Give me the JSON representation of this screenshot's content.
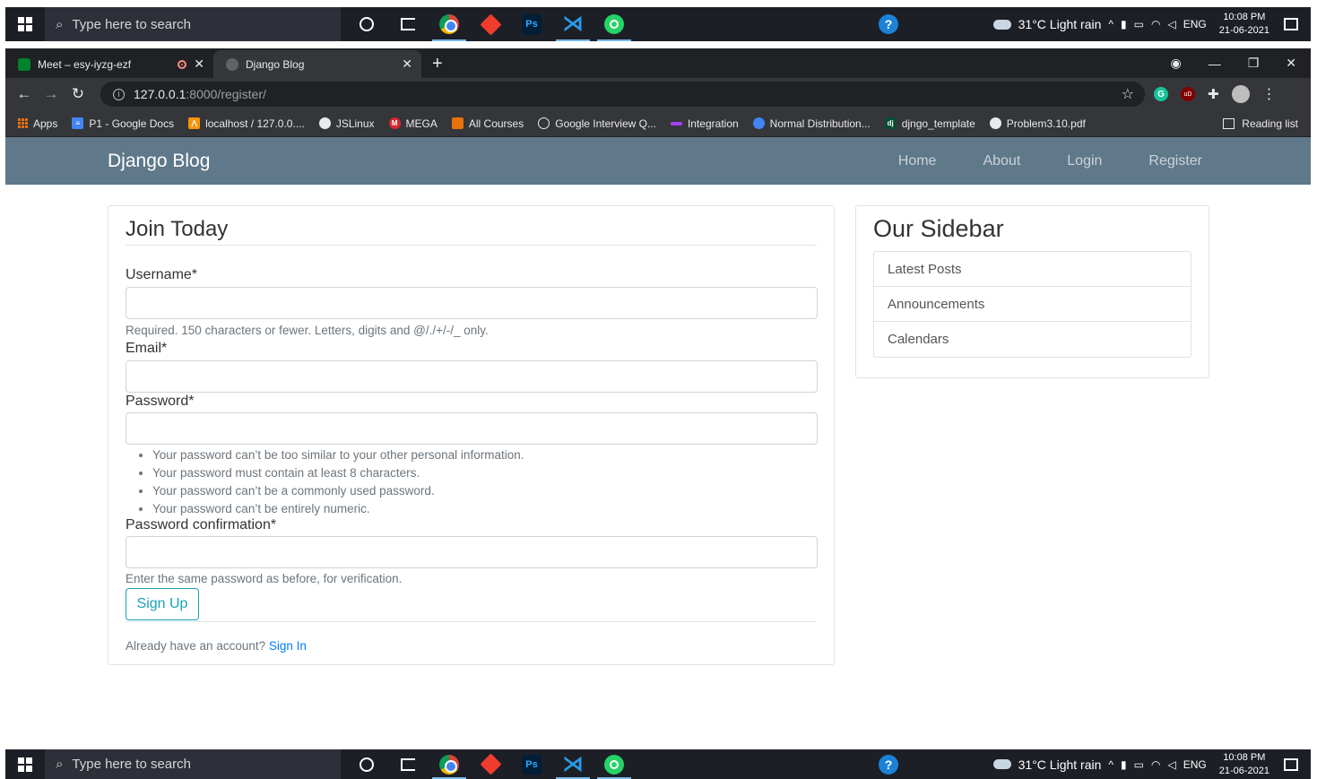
{
  "taskbar": {
    "search_placeholder": "Type here to search",
    "weather": "31°C  Light rain",
    "language": "ENG",
    "time": "10:08 PM",
    "date": "21-06-2021",
    "apps": [
      "cortana-icon",
      "task-view-icon",
      "chrome-icon",
      "git-icon",
      "photoshop-icon",
      "vscode-icon",
      "whatsapp-icon"
    ]
  },
  "browser": {
    "tabs": [
      {
        "title": "Meet – esy-iyzg-ezf",
        "favicon_color": "#00832d"
      },
      {
        "title": "Django Blog",
        "favicon_color": "#9aa0a6"
      }
    ],
    "url_host": "127.0.0.1",
    "url_path": ":8000/register/",
    "bookmarks": [
      {
        "label": "Apps"
      },
      {
        "label": "P1 - Google Docs",
        "color": "#4285f4"
      },
      {
        "label": "localhost / 127.0.0....",
        "color": "#f89406"
      },
      {
        "label": "JSLinux",
        "color": "#e8eaed"
      },
      {
        "label": "MEGA",
        "color": "#d9272e"
      },
      {
        "label": "All Courses",
        "color": "#e8710a"
      },
      {
        "label": "Google Interview Q...",
        "color": "#e8eaed"
      },
      {
        "label": "Integration",
        "color": "#a142f4"
      },
      {
        "label": "Normal Distribution...",
        "color": "#4285f4"
      },
      {
        "label": "djngo_template",
        "color": "#0c4b33"
      },
      {
        "label": "Problem3.10.pdf",
        "color": "#e8eaed"
      }
    ],
    "reading_list": "Reading list"
  },
  "site": {
    "brand": "Django Blog",
    "nav": [
      "Home",
      "About",
      "Login",
      "Register"
    ]
  },
  "form": {
    "legend": "Join Today",
    "username_label": "Username*",
    "username_help": "Required. 150 characters or fewer. Letters, digits and @/./+/-/_ only.",
    "email_label": "Email*",
    "password_label": "Password*",
    "password_rules": [
      "Your password can’t be too similar to your other personal information.",
      "Your password must contain at least 8 characters.",
      "Your password can’t be a commonly used password.",
      "Your password can’t be entirely numeric."
    ],
    "password2_label": "Password confirmation*",
    "password2_help": "Enter the same password as before, for verification.",
    "submit": "Sign Up",
    "already": "Already have an account?",
    "signin": "Sign In"
  },
  "sidebar": {
    "title": "Our Sidebar",
    "items": [
      "Latest Posts",
      "Announcements",
      "Calendars"
    ]
  },
  "colors": {
    "navbar": "#5f788a",
    "accent_button": "#17a2b8",
    "link": "#007bff"
  }
}
